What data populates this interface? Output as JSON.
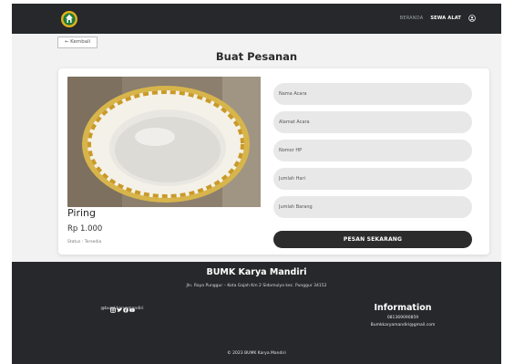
{
  "header": {
    "nav": {
      "home": "BERANDA",
      "rent": "SEWA ALAT"
    },
    "icons": {
      "logo": "logo-emblem-icon",
      "user": "user-icon"
    }
  },
  "page": {
    "back_label": "← Kembali",
    "title": "Buat Pesanan"
  },
  "product": {
    "name": "Piring",
    "price": "Rp 1.000",
    "status": "Status : Tersedia"
  },
  "form": {
    "event_name_placeholder": "Nama Acara",
    "event_address_placeholder": "Alamat Acara",
    "phone_placeholder": "Nomor HP",
    "days_placeholder": "Jumlah Hari",
    "quantity_placeholder": "Jumlah Barang",
    "submit_label": "PESAN SEKARANG"
  },
  "footer": {
    "title": "BUMK Karya Mandiri",
    "address": "Jln. Raya Punggur – Kota Gajah Km 2 Sidomulyo kec. Punggur 34152",
    "social_handle": "@bumkkaryamandiri",
    "social_icons": [
      "instagram-icon",
      "twitter-icon",
      "facebook-icon",
      "youtube-icon"
    ],
    "info_title": "Information",
    "phone": "081369090859",
    "email": "Bumkkaryamandiri@gmail.com",
    "copyright": "© 2023 BUMK Karya Mandiri"
  },
  "colors": {
    "dark": "#26282b",
    "field_bg": "#e8e8e8",
    "button": "#2c2c2c",
    "page_bg": "#f2f2f2"
  }
}
